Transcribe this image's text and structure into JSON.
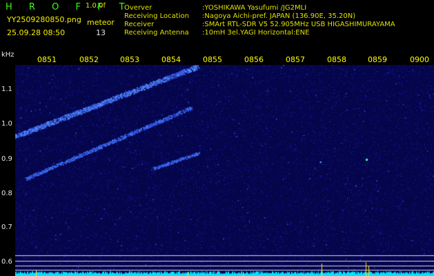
{
  "header": {
    "brand": "H R O F F T",
    "version": "1.0.0f",
    "filename": "YY2509280850.png",
    "datetime": "25.09.28 08:50",
    "meteor_label": "meteor",
    "meteor_count": "13"
  },
  "station_info": [
    {
      "label": "Overver",
      "value": ":YOSHIKAWA Yasufumi /JG2MLI"
    },
    {
      "label": "Receiving Location",
      "value": ":Nagoya Aichi-pref. JAPAN (136.90E, 35.20N)"
    },
    {
      "label": "Receiver",
      "value": ":SMArt RTL-SDR V5 52.905MHz USB HIGASHIMURAYAMA"
    },
    {
      "label": "Receiving Antenna",
      "value": ":10mH 3el.YAGI Horizontal:ENE"
    }
  ],
  "axes": {
    "y_unit": "kHz",
    "y_ticks": [
      "1.1",
      "1.0",
      "0.9",
      "0.8",
      "0.7",
      "0.6"
    ],
    "x_ticks": [
      "0851",
      "0852",
      "0853",
      "0854",
      "0855",
      "0856",
      "0857",
      "0858",
      "0859",
      "0900"
    ]
  },
  "colors": {
    "background": "#000000",
    "label_yellow": "#f5f000",
    "label_green": "#39ff14",
    "spectrogram_bg": "#0a0a6a",
    "noise_floor": "#00e5ff"
  }
}
